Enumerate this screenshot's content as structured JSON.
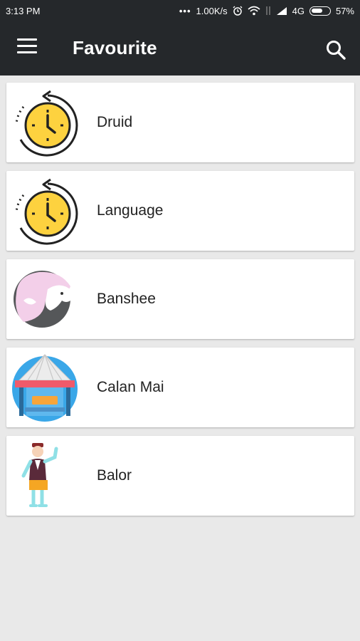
{
  "status_bar": {
    "time": "3:13 PM",
    "network_speed": "1.00K/s",
    "network_type": "4G",
    "battery": "57%"
  },
  "app_bar": {
    "title": "Favourite",
    "menu_icon": "menu-icon",
    "search_icon": "search-icon"
  },
  "favourites": [
    {
      "title": "Druid",
      "icon": "clock-history-icon"
    },
    {
      "title": "Language",
      "icon": "clock-history-icon"
    },
    {
      "title": "Banshee",
      "icon": "unicorn-icon"
    },
    {
      "title": "Calan Mai",
      "icon": "festival-stall-icon"
    },
    {
      "title": "Balor",
      "icon": "man-in-kilt-icon"
    }
  ],
  "colors": {
    "app_bar": "#25282b",
    "background": "#e9e9e9",
    "clock_yellow": "#fdd23f",
    "stall_blue": "#3aa7e8"
  }
}
